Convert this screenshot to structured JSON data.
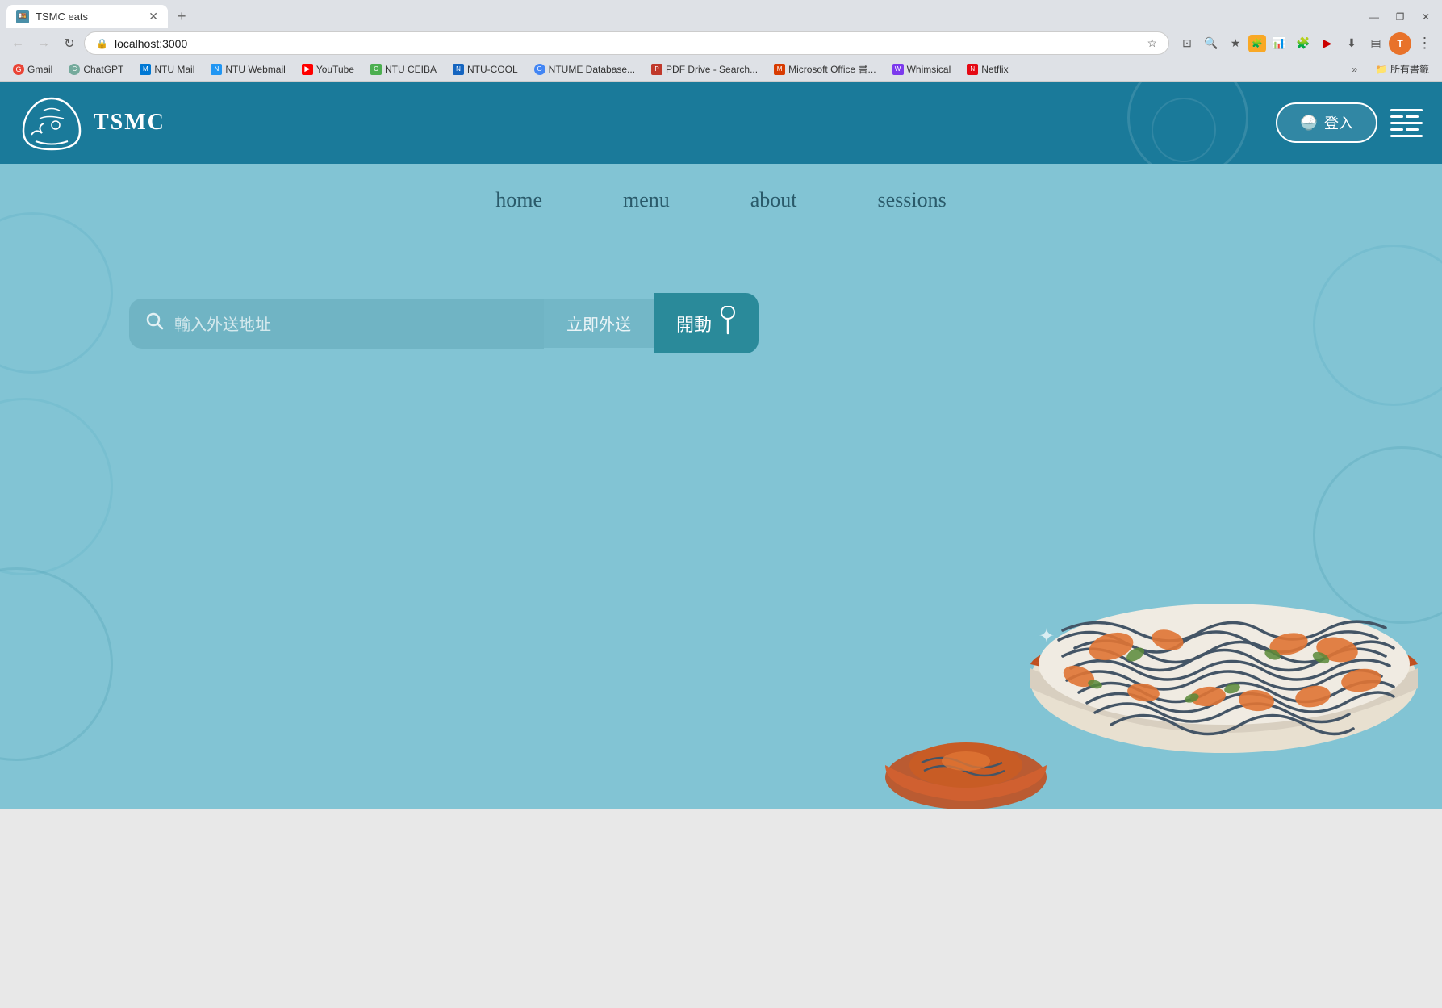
{
  "browser": {
    "tab": {
      "title": "TSMC eats",
      "url": "localhost:3000"
    },
    "bookmarks": [
      {
        "label": "Gmail",
        "favicon_color": "#EA4335",
        "favicon_text": "G"
      },
      {
        "label": "ChatGPT",
        "favicon_color": "#74aa9c",
        "favicon_text": "C"
      },
      {
        "label": "NTU Mail",
        "favicon_color": "#0078d4",
        "favicon_text": "M"
      },
      {
        "label": "NTU Webmail",
        "favicon_color": "#2196F3",
        "favicon_text": "N"
      },
      {
        "label": "YouTube",
        "favicon_color": "#FF0000",
        "favicon_text": "▶"
      },
      {
        "label": "NTU CEIBA",
        "favicon_color": "#4CAF50",
        "favicon_text": "C"
      },
      {
        "label": "NTU-COOL",
        "favicon_color": "#2196F3",
        "favicon_text": "N"
      },
      {
        "label": "NTUME Database...",
        "favicon_color": "#4285F4",
        "favicon_text": "G"
      },
      {
        "label": "PDF Drive - Search...",
        "favicon_color": "#c0392b",
        "favicon_text": "P"
      },
      {
        "label": "Microsoft Office 書...",
        "favicon_color": "#D83B01",
        "favicon_text": "M"
      },
      {
        "label": "Whimsical",
        "favicon_color": "#7c3aed",
        "favicon_text": "W"
      },
      {
        "label": "Netflix",
        "favicon_color": "#E50914",
        "favicon_text": "N"
      }
    ],
    "more_label": "»",
    "folder_label": "所有書籤"
  },
  "site": {
    "title": "TSMC",
    "login_button": "登入",
    "nav": {
      "items": [
        {
          "label": "home"
        },
        {
          "label": "menu"
        },
        {
          "label": "about"
        },
        {
          "label": "sessions"
        }
      ]
    },
    "search": {
      "placeholder": "輸入外送地址",
      "delivery_label": "立即外送",
      "go_label": "開動"
    },
    "colors": {
      "header_bg": "#1a7a9a",
      "main_bg": "#82c4d4",
      "go_btn_bg": "#2a8a9a",
      "nav_text": "#2a5a6a"
    }
  }
}
